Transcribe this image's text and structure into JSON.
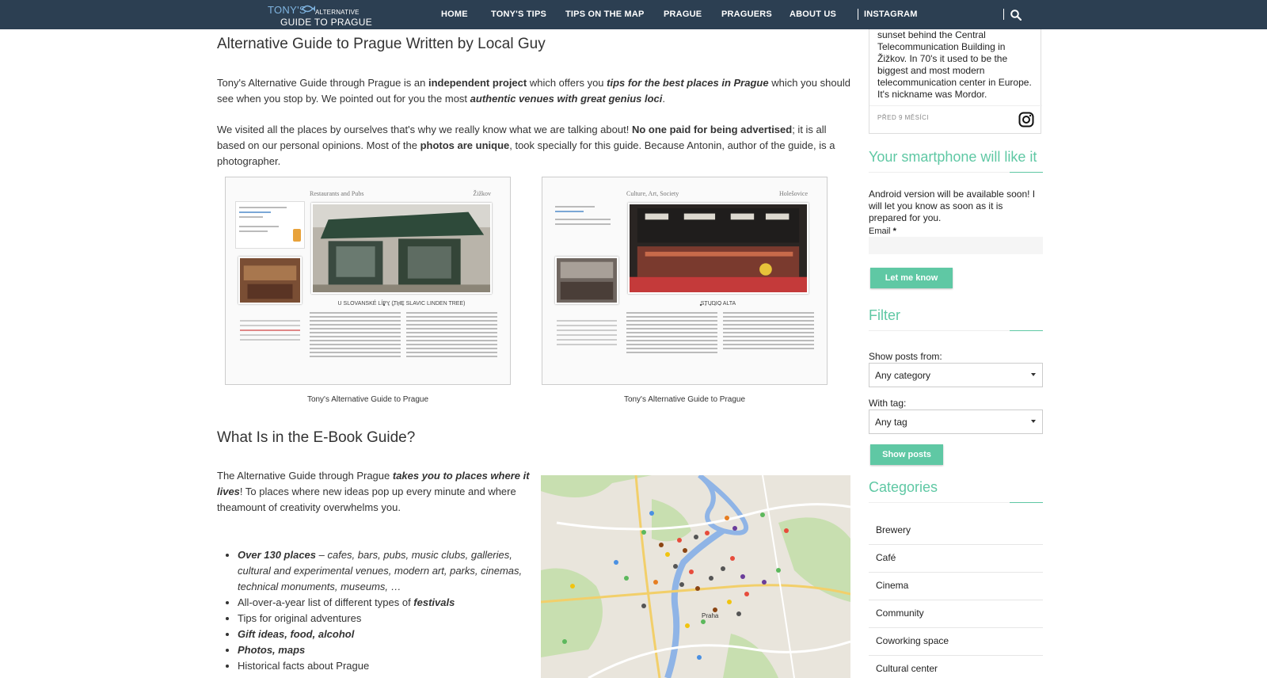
{
  "header": {
    "logo_line1": "TONY'S",
    "logo_line1b": "ALTERNATIVE",
    "logo_line2": "GUIDE TO PRAGUE",
    "nav": [
      "HOME",
      "TONY'S TIPS",
      "TIPS ON THE MAP",
      "PRAGUE",
      "PRAGUERS",
      "ABOUT US",
      "INSTAGRAM"
    ]
  },
  "main": {
    "title": "Alternative Guide to Prague Written by Local Guy",
    "p1": {
      "a": "Tony's Alternative Guide through Prague is an ",
      "b": "independent project",
      "c": " which offers you ",
      "d": "tips for the best places in Prague",
      "e": " which you should see when you stop by. We pointed out for you the most ",
      "f": "authentic venues with great genius loci",
      "g": "."
    },
    "p2": {
      "a": "We visited all the places by ourselves that's why we really know what we are talking about! ",
      "b": "No one paid for being advertised",
      "c": "; it is all based on our personal opinions. Most of the ",
      "d": "photos are unique",
      "e": ", took specially for this guide. Because Antonin, author of the guide, is a photographer."
    },
    "figures": [
      {
        "category": "Restaurants and Pubs",
        "district": "Žižkov",
        "venue": "U SLOVANSKÉ LÍPY (THE SLAVIC LINDEN TREE)",
        "caption": "Tony's Alternative Guide to Prague"
      },
      {
        "category": "Culture, Art, Society",
        "district": "Holešovice",
        "venue": "STUDIO ALTA",
        "caption": "Tony's Alternative Guide to Prague"
      }
    ],
    "section2_title": "What Is in the E-Book Guide?",
    "intro2": {
      "a": "The Alternative Guide through Prague ",
      "b": "takes you to places where it lives",
      "c": "! To places where new ideas pop up every minute and where theamount of creativity overwhelms you."
    },
    "features": [
      {
        "bold": "Over 130 places",
        "rest": " – cafes, bars, pubs, music clubs, galleries, cultural and experimental venues, modern art, parks, cinemas, technical monuments, museums, …"
      },
      {
        "pre": "All-over-a-year list of different types of ",
        "bold": "festivals"
      },
      {
        "pre": "Tips for original adventures"
      },
      {
        "bold": "Gift ideas, food, alcohol"
      },
      {
        "bold": "Photos, maps"
      },
      {
        "pre": "Historical facts about Prague"
      }
    ],
    "map_label": "Praha"
  },
  "sidebar": {
    "instagram_caption": "sunset behind the Central Telecommunication Building in Žižkov. In 70's it used to be the biggest and most modern telecommunication center in Europe. It's nickname was Mordor.",
    "instagram_time": "PŘED 9 MĚSÍCI",
    "smartphone_title": "Your smartphone will like it",
    "smartphone_text": "Android version will be available soon! I will let you know as soon as it is prepared for you.",
    "email_label": "Email",
    "email_required": "*",
    "notify_button": "Let me know",
    "filter_title": "Filter",
    "show_posts_from_label": "Show posts from:",
    "category_select": "Any category",
    "with_tag_label": "With tag:",
    "tag_select": "Any tag",
    "show_posts_button": "Show posts",
    "categories_title": "Categories",
    "categories": [
      "Brewery",
      "Café",
      "Cinema",
      "Community",
      "Coworking space",
      "Cultural center"
    ]
  },
  "colors": {
    "nav_bg": "#2c3f52",
    "accent": "#5fc8a4"
  }
}
